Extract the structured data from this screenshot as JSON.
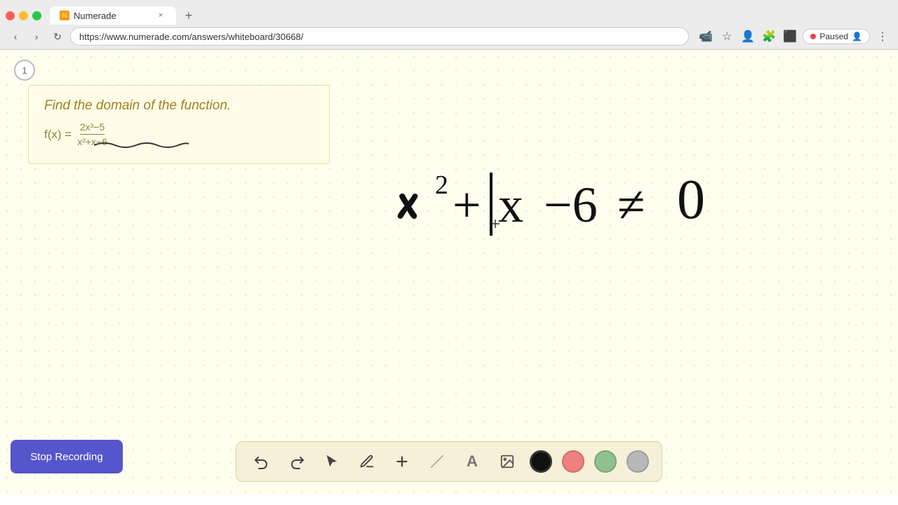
{
  "browser": {
    "tab_title": "Numerade",
    "tab_close": "×",
    "tab_new": "+",
    "url": "https://www.numerade.com/answers/whiteboard/30668/",
    "nav_back": "‹",
    "nav_forward": "›",
    "nav_refresh": "↻",
    "paused_label": "Paused",
    "toolbar_icons": [
      "📹",
      "★",
      "👤",
      "🌐",
      "⬛",
      "☰"
    ]
  },
  "page": {
    "page_number": "1",
    "question": {
      "prompt": "Find the domain of the function.",
      "formula_left": "f(x) =",
      "numerator": "2x³−5",
      "denominator": "x²+x−6"
    },
    "whiteboard_expression": "x²+|x  −6 ≠ 0"
  },
  "toolbar": {
    "undo_label": "↺",
    "redo_label": "↻",
    "select_label": "↖",
    "pen_label": "✏",
    "add_label": "+",
    "eraser_label": "/",
    "text_label": "A",
    "image_label": "🖼",
    "colors": [
      "#111111",
      "#f08080",
      "#90c090",
      "#b8b8b8"
    ],
    "color_names": [
      "black",
      "pink",
      "green",
      "gray"
    ]
  },
  "stop_recording": {
    "label": "Stop Recording"
  }
}
